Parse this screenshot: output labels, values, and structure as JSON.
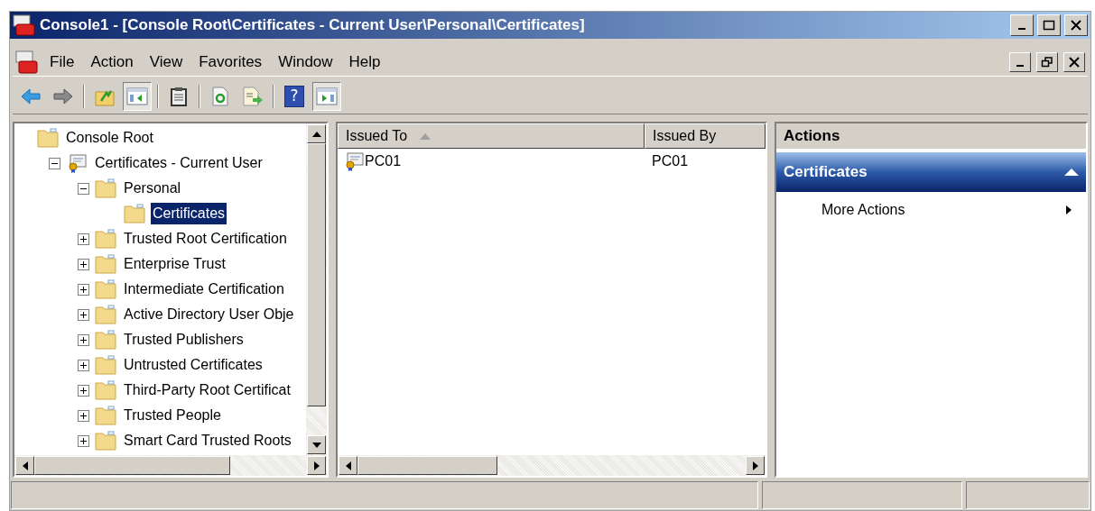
{
  "window": {
    "title": "Console1 - [Console Root\\Certificates - Current User\\Personal\\Certificates]"
  },
  "menu": [
    "File",
    "Action",
    "View",
    "Favorites",
    "Window",
    "Help"
  ],
  "toolbar": [
    {
      "kind": "back",
      "pressed": false
    },
    {
      "kind": "forward",
      "pressed": false
    },
    {
      "kind": "sep"
    },
    {
      "kind": "up",
      "pressed": false
    },
    {
      "kind": "tree",
      "pressed": true
    },
    {
      "kind": "sep"
    },
    {
      "kind": "clipboard",
      "pressed": false
    },
    {
      "kind": "sep"
    },
    {
      "kind": "refresh",
      "pressed": false
    },
    {
      "kind": "export",
      "pressed": false
    },
    {
      "kind": "sep"
    },
    {
      "kind": "help",
      "pressed": false,
      "glyph": "?"
    },
    {
      "kind": "actionpane",
      "pressed": true
    }
  ],
  "tree": [
    {
      "label": "Console Root",
      "kind": "folder",
      "selected": false,
      "children": [
        {
          "label": "Certificates - Current User",
          "kind": "store",
          "selected": false,
          "expanded": true,
          "children": [
            {
              "label": "Personal",
              "kind": "folder",
              "selected": false,
              "expanded": true,
              "children": [
                {
                  "label": "Certificates",
                  "kind": "folder",
                  "selected": true
                }
              ]
            },
            {
              "label": "Trusted Root Certification",
              "kind": "folder",
              "selected": false,
              "expanded": false
            },
            {
              "label": "Enterprise Trust",
              "kind": "folder",
              "selected": false,
              "expanded": false
            },
            {
              "label": "Intermediate Certification",
              "kind": "folder",
              "selected": false,
              "expanded": false
            },
            {
              "label": "Active Directory User Obje",
              "kind": "folder",
              "selected": false,
              "expanded": false
            },
            {
              "label": "Trusted Publishers",
              "kind": "folder",
              "selected": false,
              "expanded": false
            },
            {
              "label": "Untrusted Certificates",
              "kind": "folder",
              "selected": false,
              "expanded": false
            },
            {
              "label": "Third-Party Root Certificat",
              "kind": "folder",
              "selected": false,
              "expanded": false
            },
            {
              "label": "Trusted People",
              "kind": "folder",
              "selected": false,
              "expanded": false
            },
            {
              "label": "Smart Card Trusted Roots",
              "kind": "folder",
              "selected": false,
              "expanded": false
            }
          ]
        }
      ]
    }
  ],
  "list": {
    "columns": [
      {
        "label": "Issued To",
        "sorted": true
      },
      {
        "label": "Issued By",
        "sorted": false
      }
    ],
    "rows": [
      {
        "cells": [
          "PC01",
          "PC01"
        ]
      }
    ]
  },
  "actions": {
    "title": "Actions",
    "sections": [
      {
        "title": "Certificates",
        "expanded": true,
        "items": [
          "More Actions"
        ]
      }
    ]
  }
}
